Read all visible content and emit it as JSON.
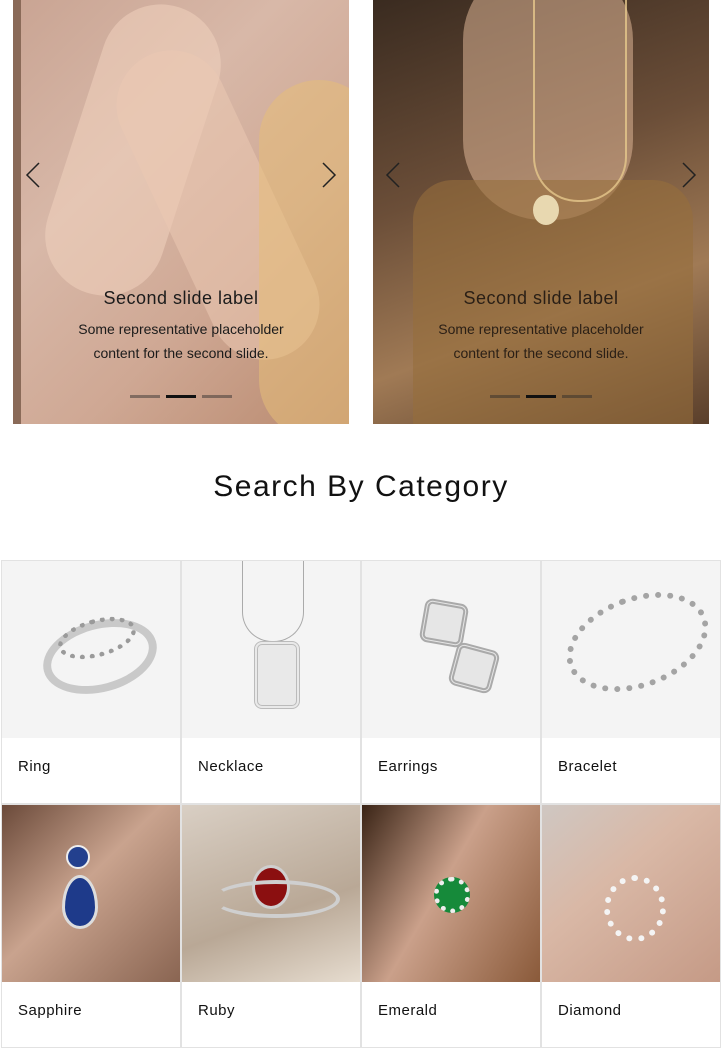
{
  "carousels": [
    {
      "caption_label": "Second slide label",
      "caption_text": "Some representative placeholder content for the second slide.",
      "indicators": [
        "slide-1",
        "slide-2",
        "slide-3"
      ],
      "active_index": 1
    },
    {
      "caption_label": "Second slide label",
      "caption_text": "Some representative placeholder content for the second slide.",
      "indicators": [
        "slide-1",
        "slide-2",
        "slide-3"
      ],
      "active_index": 1
    }
  ],
  "section": {
    "title": "Search By Category"
  },
  "categories": [
    {
      "name": "Ring",
      "image": "ring-image"
    },
    {
      "name": "Necklace",
      "image": "necklace-image"
    },
    {
      "name": "Earrings",
      "image": "earrings-image"
    },
    {
      "name": "Bracelet",
      "image": "bracelet-image"
    },
    {
      "name": "Sapphire",
      "image": "sapphire-image"
    },
    {
      "name": "Ruby",
      "image": "ruby-image"
    },
    {
      "name": "Emerald",
      "image": "emerald-image"
    },
    {
      "name": "Diamond",
      "image": "diamond-image"
    }
  ],
  "icons": {
    "prev": "chevron-left-icon",
    "next": "chevron-right-icon"
  }
}
